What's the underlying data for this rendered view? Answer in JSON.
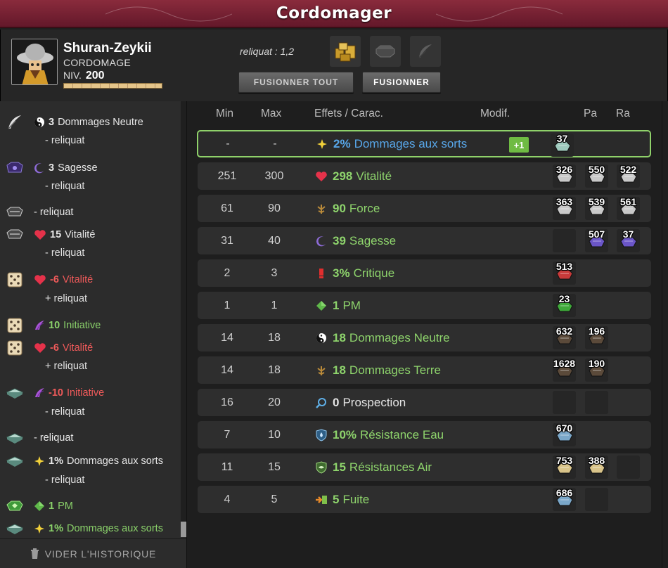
{
  "window": {
    "title": "Cordomager"
  },
  "player": {
    "name": "Shuran-Zeykii",
    "job": "CORDOMAGE",
    "level_label": "NIV.",
    "level": "200",
    "xp_fraction": 1.0
  },
  "reliquat": "reliquat : 1,2",
  "slots": [
    {
      "icon": "golden-rune-bag-icon"
    },
    {
      "icon": "octagon-stone-icon"
    },
    {
      "icon": "feather-icon"
    }
  ],
  "buttons": {
    "fuse_all": "FUSIONNER TOUT",
    "fuse": "FUSIONNER"
  },
  "history": [
    {
      "icon": "feather-quill-icon",
      "effect_icon": "yin-yang-icon",
      "val": "3",
      "label": "Dommages Neutre",
      "cls": "",
      "sub": "- reliquat"
    },
    {
      "icon": "purple-rune-icon",
      "effect_icon": "moon-icon",
      "val": "3",
      "label": "Sagesse",
      "cls": "",
      "sub": "- reliquat"
    },
    {
      "icon": "gray-rune-icon",
      "effect_icon": "",
      "val": "",
      "label": "- reliquat",
      "cls": "",
      "sub": ""
    },
    {
      "icon": "gray-rune-icon",
      "effect_icon": "heart-icon",
      "val": "15",
      "label": "Vitalité",
      "cls": "",
      "sub": "- reliquat"
    },
    {
      "icon": "dice-icon",
      "effect_icon": "heart-icon",
      "val": "-6",
      "label": "Vitalité",
      "cls": "r",
      "sub": "+ reliquat"
    },
    {
      "icon": "dice-icon",
      "effect_icon": "wing-icon",
      "val": "10",
      "label": "Initiative",
      "cls": "g",
      "sub": ""
    },
    {
      "icon": "dice-icon",
      "effect_icon": "heart-icon",
      "val": "-6",
      "label": "Vitalité",
      "cls": "r",
      "sub": "+ reliquat"
    },
    {
      "icon": "book-rune-icon",
      "effect_icon": "wing-icon",
      "val": "-10",
      "label": "Initiative",
      "cls": "r",
      "sub": "- reliquat"
    },
    {
      "icon": "book-rune-icon",
      "effect_icon": "",
      "val": "",
      "label": "- reliquat",
      "cls": "",
      "sub": ""
    },
    {
      "icon": "book-rune-icon",
      "effect_icon": "star-icon",
      "val": "1%",
      "label": "Dommages aux sorts",
      "cls": "",
      "sub": "- reliquat"
    },
    {
      "icon": "green-rune-icon",
      "effect_icon": "diamond-icon",
      "val": "1",
      "label": "PM",
      "cls": "g",
      "sub": ""
    },
    {
      "icon": "book-rune-icon",
      "effect_icon": "star-icon",
      "val": "1%",
      "label": "Dommages aux sorts",
      "cls": "g",
      "sub": ""
    }
  ],
  "clear_history": "VIDER L'HISTORIQUE",
  "columns": {
    "min": "Min",
    "max": "Max",
    "effects": "Effets / Carac.",
    "modif": "Modif.",
    "pa": "Pa",
    "ra": "Ra"
  },
  "rows": [
    {
      "min": "-",
      "max": "-",
      "icon": "star-icon",
      "val": "2%",
      "label": "Dommages aux sorts",
      "color": "bl",
      "badge": "+1",
      "runes": [
        {
          "n": "37",
          "kind": "book"
        },
        null,
        null
      ]
    },
    {
      "min": "251",
      "max": "300",
      "icon": "heart-icon",
      "val": "298",
      "label": "Vitalité",
      "color": "gr",
      "badge": "",
      "runes": [
        {
          "n": "326",
          "kind": "gray"
        },
        {
          "n": "550",
          "kind": "gray"
        },
        {
          "n": "522",
          "kind": "gray"
        }
      ]
    },
    {
      "min": "61",
      "max": "90",
      "icon": "force-icon",
      "val": "90",
      "label": "Force",
      "color": "gr",
      "badge": "",
      "runes": [
        {
          "n": "363",
          "kind": "gray"
        },
        {
          "n": "539",
          "kind": "gray"
        },
        {
          "n": "561",
          "kind": "gray"
        }
      ]
    },
    {
      "min": "31",
      "max": "40",
      "icon": "moon-icon",
      "val": "39",
      "label": "Sagesse",
      "color": "gr",
      "badge": "",
      "runes": [
        {
          "n": "",
          "kind": "empty"
        },
        {
          "n": "507",
          "kind": "purple"
        },
        {
          "n": "37",
          "kind": "purple"
        }
      ]
    },
    {
      "min": "2",
      "max": "3",
      "icon": "exclaim-icon",
      "val": "3%",
      "label": "Critique",
      "color": "gr",
      "badge": "",
      "runes": [
        {
          "n": "513",
          "kind": "red"
        },
        null,
        null
      ]
    },
    {
      "min": "1",
      "max": "1",
      "icon": "diamond-icon",
      "val": "1",
      "label": "PM",
      "color": "gr",
      "badge": "",
      "runes": [
        {
          "n": "23",
          "kind": "green"
        },
        null,
        null
      ]
    },
    {
      "min": "14",
      "max": "18",
      "icon": "yin-yang-icon",
      "val": "18",
      "label": "Dommages Neutre",
      "color": "gr",
      "badge": "",
      "runes": [
        {
          "n": "632",
          "kind": "dark"
        },
        {
          "n": "196",
          "kind": "dark"
        },
        null
      ]
    },
    {
      "min": "14",
      "max": "18",
      "icon": "force-icon",
      "val": "18",
      "label": "Dommages Terre",
      "color": "gr",
      "badge": "",
      "runes": [
        {
          "n": "1628",
          "kind": "dark"
        },
        {
          "n": "190",
          "kind": "dark"
        },
        null
      ]
    },
    {
      "min": "16",
      "max": "20",
      "icon": "magnifier-icon",
      "val": "0",
      "label": "Prospection",
      "color": "wh",
      "badge": "",
      "runes": [
        {
          "n": "",
          "kind": "empty"
        },
        {
          "n": "",
          "kind": "empty"
        },
        null
      ]
    },
    {
      "min": "7",
      "max": "10",
      "icon": "water-shield-icon",
      "val": "10%",
      "label": "Résistance Eau",
      "color": "gr",
      "badge": "",
      "runes": [
        {
          "n": "670",
          "kind": "blue"
        },
        null,
        null
      ]
    },
    {
      "min": "11",
      "max": "15",
      "icon": "air-shield-icon",
      "val": "15",
      "label": "Résistances Air",
      "color": "gr",
      "badge": "",
      "runes": [
        {
          "n": "753",
          "kind": "gold"
        },
        {
          "n": "388",
          "kind": "gold"
        },
        {
          "n": "",
          "kind": "empty"
        }
      ]
    },
    {
      "min": "4",
      "max": "5",
      "icon": "flee-icon",
      "val": "5",
      "label": "Fuite",
      "color": "gr",
      "badge": "",
      "runes": [
        {
          "n": "686",
          "kind": "blue"
        },
        {
          "n": "",
          "kind": "empty"
        },
        null
      ]
    }
  ]
}
